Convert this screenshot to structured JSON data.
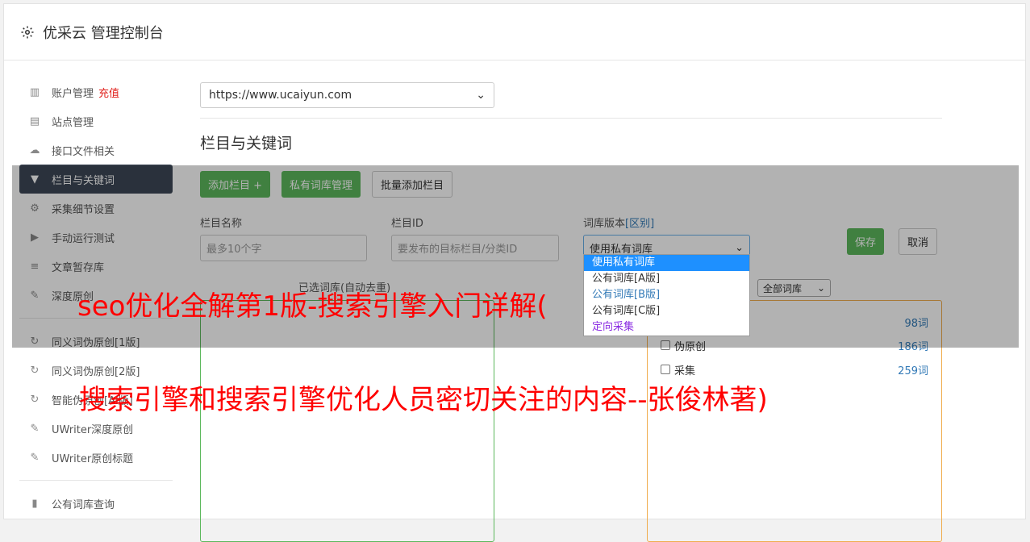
{
  "header": {
    "title": "优采云 管理控制台",
    "icon": "gear-icon"
  },
  "sidebar": {
    "items": [
      {
        "label": "账户管理",
        "badge": "充值",
        "icon": "bar-chart-icon"
      },
      {
        "label": "站点管理",
        "icon": "server-icon"
      },
      {
        "label": "接口文件相关",
        "icon": "cloud-upload-icon"
      },
      {
        "label": "栏目与关键词",
        "icon": "filter-icon",
        "active": true
      },
      {
        "label": "采集细节设置",
        "icon": "gears-icon"
      },
      {
        "label": "手动运行测试",
        "icon": "play-circle-icon"
      },
      {
        "label": "文章暂存库",
        "icon": "database-icon"
      },
      {
        "label": "深度原创",
        "icon": "edit-icon"
      }
    ],
    "items2": [
      {
        "label": "同义词伪原创[1版]",
        "icon": "refresh-icon"
      },
      {
        "label": "同义词伪原创[2版]",
        "icon": "refresh-icon"
      },
      {
        "label": "智能伪原创[AI版]",
        "icon": "refresh-icon"
      },
      {
        "label": "UWriter深度原创",
        "icon": "edit-icon"
      },
      {
        "label": "UWriter原创标题",
        "icon": "edit-icon"
      }
    ],
    "items3": [
      {
        "label": "公有词库查询",
        "icon": "book-icon"
      }
    ]
  },
  "main": {
    "site_select": "https://www.ucaiyun.com",
    "section_title": "栏目与关键词",
    "buttons": {
      "add_column": "添加栏目 +",
      "private_lib": "私有词库管理",
      "batch_add": "批量添加栏目"
    },
    "form": {
      "name_label": "栏目名称",
      "name_placeholder": "最多10个字",
      "id_label": "栏目ID",
      "id_placeholder": "要发布的目标栏目/分类ID",
      "version_label": "词库版本",
      "version_link": "[区别]",
      "version_selected": "使用私有词库",
      "save": "保存",
      "cancel": "取消"
    },
    "dropdown_options": [
      "使用私有词库",
      "公有词库[A版]",
      "公有词库[B版]",
      "公有词库[C版]",
      "定向采集"
    ],
    "lists": {
      "selected_label": "已选词库(自动去重)",
      "filter_select": "全部词库",
      "library": [
        {
          "name": "",
          "count": "98词"
        },
        {
          "name": "伪原创",
          "count": "186词"
        },
        {
          "name": "采集",
          "count": "259词"
        }
      ]
    }
  },
  "watermark": {
    "line1": "seo优化全解第1版-搜索引擎入门详解(",
    "line2": "搜索引擎和搜索引擎优化人员密切关注的内容--张俊林著)"
  },
  "colors": {
    "green": "#5cb85c",
    "orange": "#f0ad4e",
    "active_nav": "#3d4756",
    "red": "#ff0000"
  }
}
